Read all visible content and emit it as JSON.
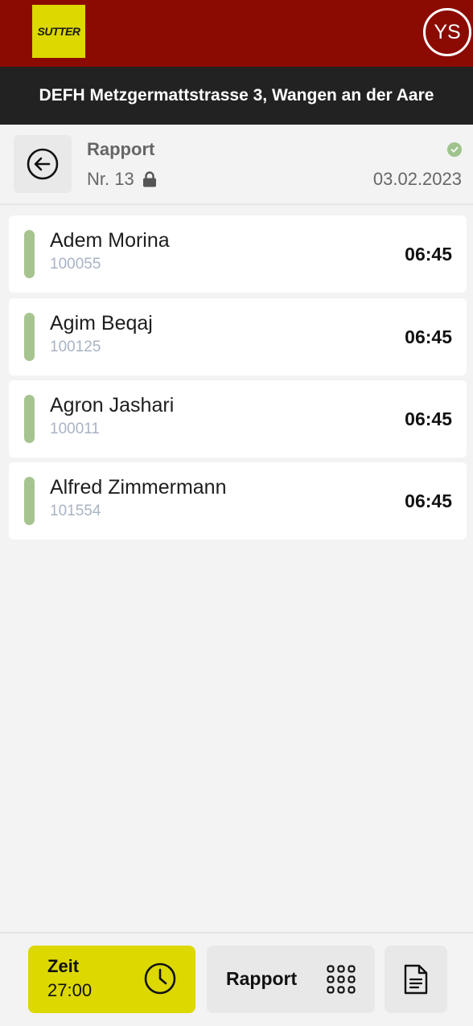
{
  "app": {
    "logo_text": "SUTTER",
    "user_initials": "YS",
    "project_title": "DEFH Metzgermattstrasse 3, Wangen an der Aare"
  },
  "header": {
    "title": "Rapport",
    "number": "Nr. 13",
    "date": "03.02.2023",
    "status_icon": "check-circle-icon",
    "lock_icon": "lock-icon",
    "back_icon": "arrow-left-circle-icon"
  },
  "employees": [
    {
      "name": "Adem Morina",
      "id": "100055",
      "time": "06:45"
    },
    {
      "name": "Agim Beqaj",
      "id": "100125",
      "time": "06:45"
    },
    {
      "name": "Agron Jashari",
      "id": "100011",
      "time": "06:45"
    },
    {
      "name": "Alfred Zimmermann",
      "id": "101554",
      "time": "06:45"
    }
  ],
  "bottom_nav": {
    "zeit_label": "Zeit",
    "zeit_value": "27:00",
    "rapport_label": "Rapport",
    "zeit_icon": "clock-icon",
    "rapport_icon": "grid-icon",
    "doc_icon": "document-icon"
  },
  "colors": {
    "brand_red": "#8b0b02",
    "brand_yellow": "#dcd800",
    "project_bar": "#222222",
    "status_green": "#a6c48f",
    "background": "#f3f3f3"
  }
}
